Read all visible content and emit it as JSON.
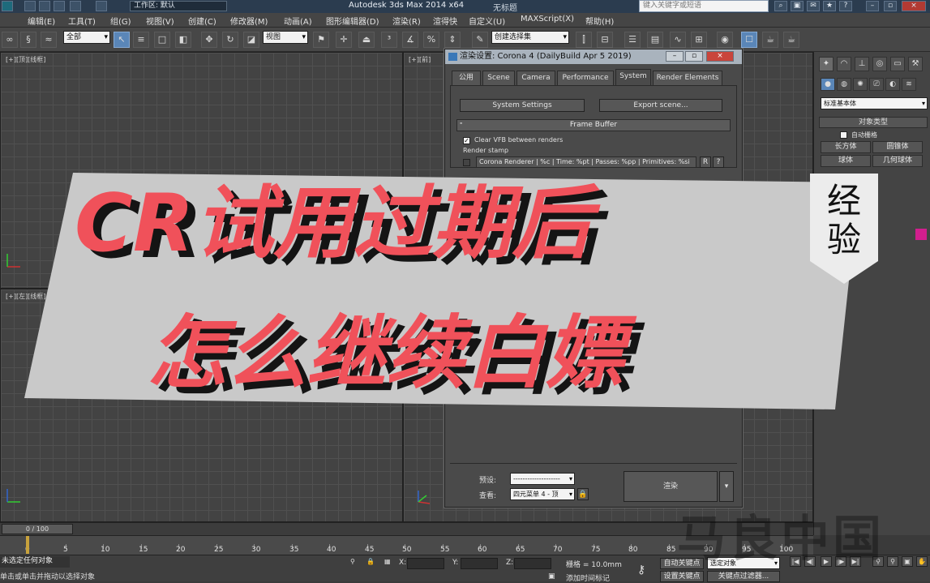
{
  "titlebar": {
    "workspace": "工作区: 默认",
    "app_title": "Autodesk 3ds Max  2014 x64",
    "file_title": "无标题",
    "search_placeholder": "键入关键字或短语"
  },
  "menubar": [
    "编辑(E)",
    "工具(T)",
    "组(G)",
    "视图(V)",
    "创建(C)",
    "修改器(M)",
    "动画(A)",
    "图形编辑器(D)",
    "渲染(R)",
    "渲得快",
    "自定义(U)",
    "MAXScript(X)",
    "帮助(H)"
  ],
  "toolbar": {
    "selection_filter": "全部",
    "reference_coord": "视图",
    "named_selection": "创建选择集"
  },
  "viewports": {
    "top_left": "[+][顶][线框]",
    "top_right": "[+][前]",
    "bottom_left": "[+][左][线框]"
  },
  "command_panel": {
    "dropdown": "标准基本体",
    "rollout": "对象类型",
    "autogrid": "自动栅格",
    "buttons": [
      "长方体",
      "圆锥体",
      "球体",
      "几何球体"
    ]
  },
  "render_dialog": {
    "title": "渲染设置: Corona 4 (DailyBuild Apr  5 2019)",
    "tabs": [
      "公用",
      "Scene",
      "Camera",
      "Performance",
      "System",
      "Render Elements"
    ],
    "active_tab": "System",
    "system_settings": "System Settings",
    "export_scene": "Export scene...",
    "frame_buffer": "Frame Buffer",
    "clear_vfb": "Clear VFB between renders",
    "render_stamp": "Render stamp",
    "stamp_text": "Corona Renderer | %c | Time: %pt | Passes: %pp | Primitives: %si",
    "stamp_r": "R",
    "stamp_q": "?",
    "preset_label": "预设:",
    "preset_value": "--------------------",
    "view_label": "查看:",
    "view_value": "四元菜单 4 - 顶",
    "render_button": "渲染"
  },
  "overlay": {
    "line1": "CR试用过期后",
    "line2": "怎么继续白嫖",
    "tag1": "经",
    "tag2": "验",
    "colors": {
      "text": "#f0515a",
      "shadow": "#141414",
      "band": "#c9c9c9",
      "tag": "#ececec"
    }
  },
  "timeline": {
    "frame": "0 / 100",
    "ticks": [
      "0",
      "5",
      "10",
      "15",
      "20",
      "25",
      "30",
      "35",
      "40",
      "45",
      "50",
      "55",
      "60",
      "65",
      "70",
      "75",
      "80",
      "85",
      "90",
      "95",
      "100"
    ]
  },
  "status": {
    "selection": "未选定任何对象",
    "prompt": "单击或单击并拖动以选择对象",
    "x_label": "X:",
    "y_label": "Y:",
    "z_label": "Z:",
    "grid": "栅格 = 10.0mm",
    "add_time_tag": "添加时间标记",
    "auto_key": "自动关键点",
    "set_key": "设置关键点",
    "selected_object": "选定对象",
    "key_filters": "关键点过滤器..."
  },
  "watermark": "马良中国"
}
